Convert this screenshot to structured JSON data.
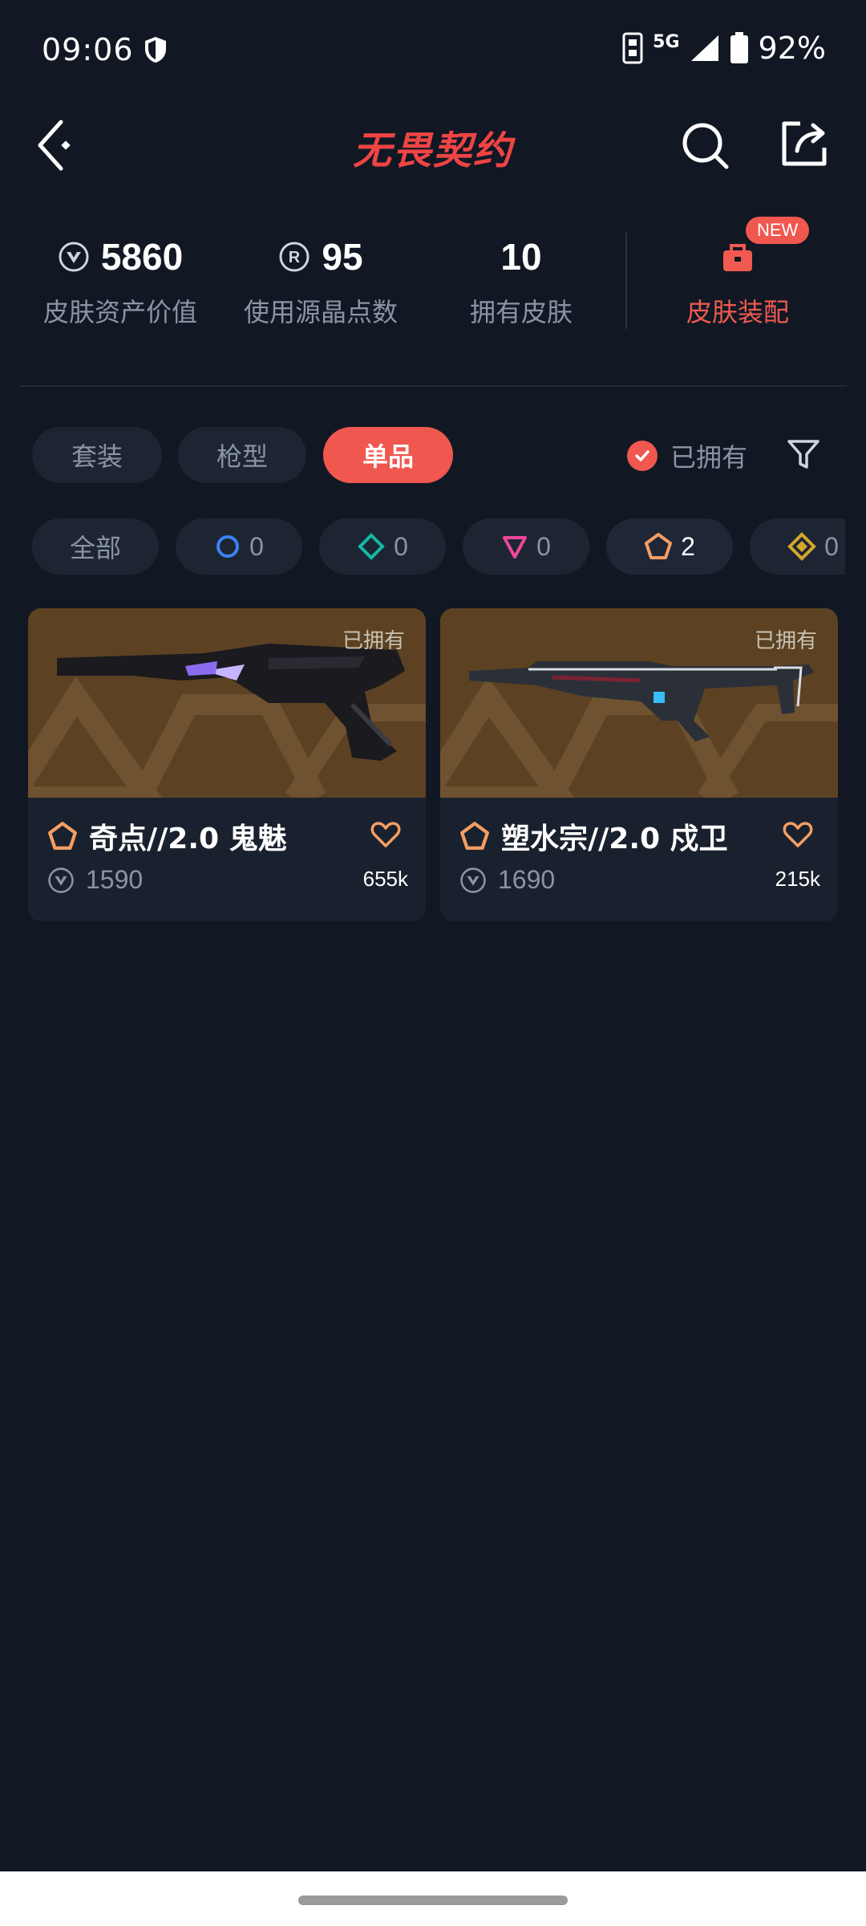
{
  "status_bar": {
    "time": "09:06",
    "network": "5G",
    "battery": "92%"
  },
  "header": {
    "title": "无畏契约"
  },
  "stats": {
    "asset_value": "5860",
    "asset_value_label": "皮肤资产价值",
    "radianite_points": "95",
    "radianite_label": "使用源晶点数",
    "owned_count": "10",
    "owned_label": "拥有皮肤",
    "loadout_badge": "NEW",
    "loadout_label": "皮肤装配"
  },
  "type_tabs": [
    {
      "label": "套装",
      "active": false
    },
    {
      "label": "枪型",
      "active": false
    },
    {
      "label": "单品",
      "active": true
    }
  ],
  "owned_filter": {
    "label": "已拥有",
    "checked": true
  },
  "rarity_chips": [
    {
      "label": "全部"
    },
    {
      "icon": "select-edition-icon",
      "count": "0",
      "color": "#3b82f6"
    },
    {
      "icon": "deluxe-edition-icon",
      "count": "0",
      "color": "#14b8a6"
    },
    {
      "icon": "premium-edition-icon",
      "count": "0",
      "color": "#ec4899"
    },
    {
      "icon": "exclusive-edition-icon",
      "count": "2",
      "color": "#f59e62"
    },
    {
      "icon": "ultra-edition-icon",
      "count": "0",
      "color": "#d4a72c"
    }
  ],
  "skins": [
    {
      "owned_label": "已拥有",
      "name": "奇点//2.0 鬼魅",
      "price": "1590",
      "likes": "655k",
      "tier_icon": "exclusive-edition-icon"
    },
    {
      "owned_label": "已拥有",
      "name": "塑水宗//2.0 戍卫",
      "price": "1690",
      "likes": "215k",
      "tier_icon": "exclusive-edition-icon"
    }
  ],
  "colors": {
    "accent": "#f0574f",
    "background": "#111824",
    "card": "#1a212e",
    "muted_text": "#8a94a6"
  }
}
